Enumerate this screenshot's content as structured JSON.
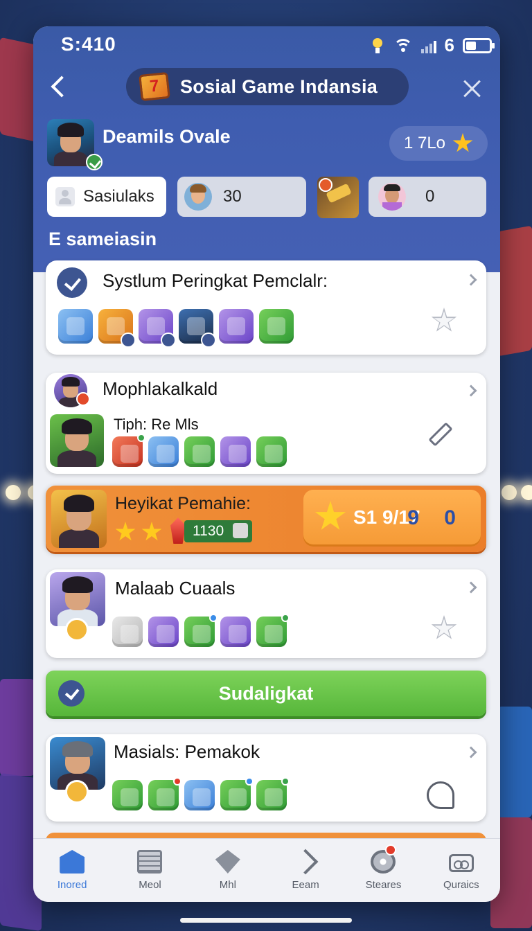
{
  "status_bar": {
    "time": "S:410",
    "battery_digit": "6"
  },
  "header": {
    "title": "Sosial Game Indansia",
    "logo_glyph": "7"
  },
  "profile": {
    "name": "Deamils Ovale",
    "level": "1 7Lo"
  },
  "stats": {
    "user_chip": "Sasiulaks",
    "count_a": "30",
    "count_b": "0"
  },
  "section_label": "E sameiasin",
  "cards": [
    {
      "title": "Systlum Peringkat Pemclalr:"
    },
    {
      "title": "Mophlakalkald",
      "subtitle": "Tiph: Re Mls"
    },
    {
      "title": "Malaab Cuaals"
    },
    {
      "title": "Masials: Pemakok"
    }
  ],
  "featured": {
    "title": "Heyikat Pemahie:",
    "score": "1130",
    "right_text": "S1 9/17",
    "right_num": "9 0"
  },
  "green_button": {
    "label": "Sudaligkat"
  },
  "bottom_nav": [
    {
      "label": "Inored"
    },
    {
      "label": "Meol"
    },
    {
      "label": "Mhl"
    },
    {
      "label": "Eeam"
    },
    {
      "label": "Steares"
    },
    {
      "label": "Quraics"
    }
  ],
  "colors": {
    "header_blue": "#3f5db0",
    "accent_orange": "#f0913a",
    "accent_green": "#56b63a",
    "nav_active": "#3b78d8"
  },
  "icons": [
    "back-icon",
    "close-icon",
    "star-icon",
    "check-icon",
    "pencil-icon",
    "helmet-icon",
    "home-icon"
  ]
}
